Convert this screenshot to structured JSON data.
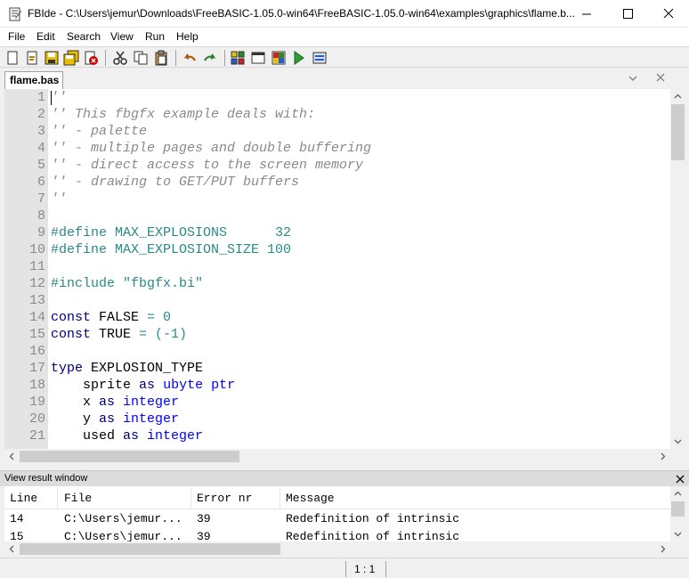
{
  "window": {
    "title": "FBIde - C:\\Users\\jemur\\Downloads\\FreeBASIC-1.05.0-win64\\FreeBASIC-1.05.0-win64\\examples\\graphics\\flame.b..."
  },
  "menu": [
    "File",
    "Edit",
    "Search",
    "View",
    "Run",
    "Help"
  ],
  "toolbar": {
    "icons": [
      "new-file-icon",
      "open-file-icon",
      "save-icon",
      "save-all-icon",
      "close-file-icon",
      "cut-icon",
      "copy-icon",
      "paste-icon",
      "undo-icon",
      "redo-icon",
      "compile-icon",
      "output-window-icon",
      "compile-run-icon",
      "run-icon",
      "console-icon"
    ]
  },
  "tabs": [
    {
      "label": "flame.bas",
      "active": true
    }
  ],
  "editor": {
    "lines": [
      {
        "n": "1",
        "segs": [
          {
            "t": "''",
            "c": "cmt"
          }
        ]
      },
      {
        "n": "2",
        "segs": [
          {
            "t": "'' This fbgfx example deals with:",
            "c": "cmt"
          }
        ]
      },
      {
        "n": "3",
        "segs": [
          {
            "t": "'' - palette",
            "c": "cmt"
          }
        ]
      },
      {
        "n": "4",
        "segs": [
          {
            "t": "'' - multiple pages and double buffering",
            "c": "cmt"
          }
        ]
      },
      {
        "n": "5",
        "segs": [
          {
            "t": "'' - direct access to the screen memory",
            "c": "cmt"
          }
        ]
      },
      {
        "n": "6",
        "segs": [
          {
            "t": "'' - drawing to GET/PUT buffers",
            "c": "cmt"
          }
        ]
      },
      {
        "n": "7",
        "segs": [
          {
            "t": "''",
            "c": "cmt"
          }
        ]
      },
      {
        "n": "8",
        "segs": []
      },
      {
        "n": "9",
        "segs": [
          {
            "t": "#define MAX_EXPLOSIONS      32",
            "c": "pre"
          }
        ]
      },
      {
        "n": "10",
        "segs": [
          {
            "t": "#define MAX_EXPLOSION_SIZE 100",
            "c": "pre"
          }
        ]
      },
      {
        "n": "11",
        "segs": []
      },
      {
        "n": "12",
        "segs": [
          {
            "t": "#include \"fbgfx.bi\"",
            "c": "pre"
          }
        ]
      },
      {
        "n": "13",
        "segs": []
      },
      {
        "n": "14",
        "segs": [
          {
            "t": "const",
            "c": "kw"
          },
          {
            "t": " FALSE ",
            "c": "id"
          },
          {
            "t": "=",
            "c": "op"
          },
          {
            "t": " 0",
            "c": "num"
          }
        ]
      },
      {
        "n": "15",
        "segs": [
          {
            "t": "const",
            "c": "kw"
          },
          {
            "t": " TRUE ",
            "c": "id"
          },
          {
            "t": "= (-1)",
            "c": "op"
          }
        ]
      },
      {
        "n": "16",
        "segs": []
      },
      {
        "n": "17",
        "segs": [
          {
            "t": "type",
            "c": "kw"
          },
          {
            "t": " EXPLOSION_TYPE",
            "c": "id"
          }
        ]
      },
      {
        "n": "18",
        "segs": [
          {
            "t": "    sprite ",
            "c": "id"
          },
          {
            "t": "as",
            "c": "kw"
          },
          {
            "t": " ",
            "c": "id"
          },
          {
            "t": "ubyte ptr",
            "c": "typ"
          }
        ]
      },
      {
        "n": "19",
        "segs": [
          {
            "t": "    x ",
            "c": "id"
          },
          {
            "t": "as",
            "c": "kw"
          },
          {
            "t": " ",
            "c": "id"
          },
          {
            "t": "integer",
            "c": "typ"
          }
        ]
      },
      {
        "n": "20",
        "segs": [
          {
            "t": "    y ",
            "c": "id"
          },
          {
            "t": "as",
            "c": "kw"
          },
          {
            "t": " ",
            "c": "id"
          },
          {
            "t": "integer",
            "c": "typ"
          }
        ]
      },
      {
        "n": "21",
        "segs": [
          {
            "t": "    used ",
            "c": "id"
          },
          {
            "t": "as",
            "c": "kw"
          },
          {
            "t": " ",
            "c": "id"
          },
          {
            "t": "integer",
            "c": "typ"
          }
        ]
      }
    ]
  },
  "results": {
    "title": "View result window",
    "columns": [
      "Line",
      "File",
      "Error nr",
      "Message"
    ],
    "rows": [
      [
        "14",
        "C:\\Users\\jemur...",
        "39",
        "Redefinition of intrinsic"
      ],
      [
        "15",
        "C:\\Users\\jemur...",
        "39",
        "Redefinition of intrinsic"
      ]
    ]
  },
  "status": {
    "position": "1 : 1"
  },
  "colors": {
    "comment": "#8a8a8a",
    "preprocessor": "#2a8a8a",
    "keyword": "#000080",
    "type": "#0000ff",
    "gutter": "#e4e4e4"
  }
}
